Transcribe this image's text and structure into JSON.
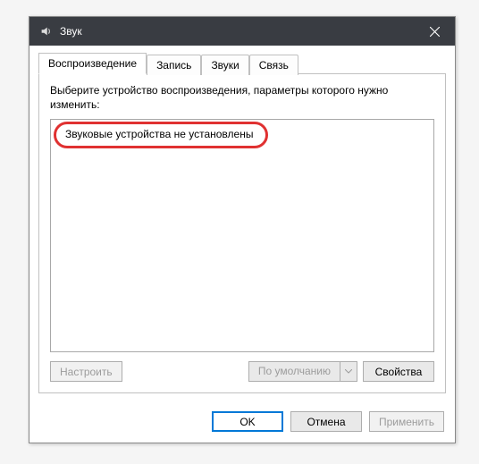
{
  "title": "Звук",
  "tabs": [
    {
      "label": "Воспроизведение",
      "active": true
    },
    {
      "label": "Запись",
      "active": false
    },
    {
      "label": "Звуки",
      "active": false
    },
    {
      "label": "Связь",
      "active": false
    }
  ],
  "instruction": "Выберите устройство воспроизведения, параметры которого нужно изменить:",
  "no_devices_message": "Звуковые устройства не установлены",
  "panel_buttons": {
    "configure": "Настроить",
    "default": "По умолчанию",
    "properties": "Свойства"
  },
  "dialog_buttons": {
    "ok": "OK",
    "cancel": "Отмена",
    "apply": "Применить"
  }
}
